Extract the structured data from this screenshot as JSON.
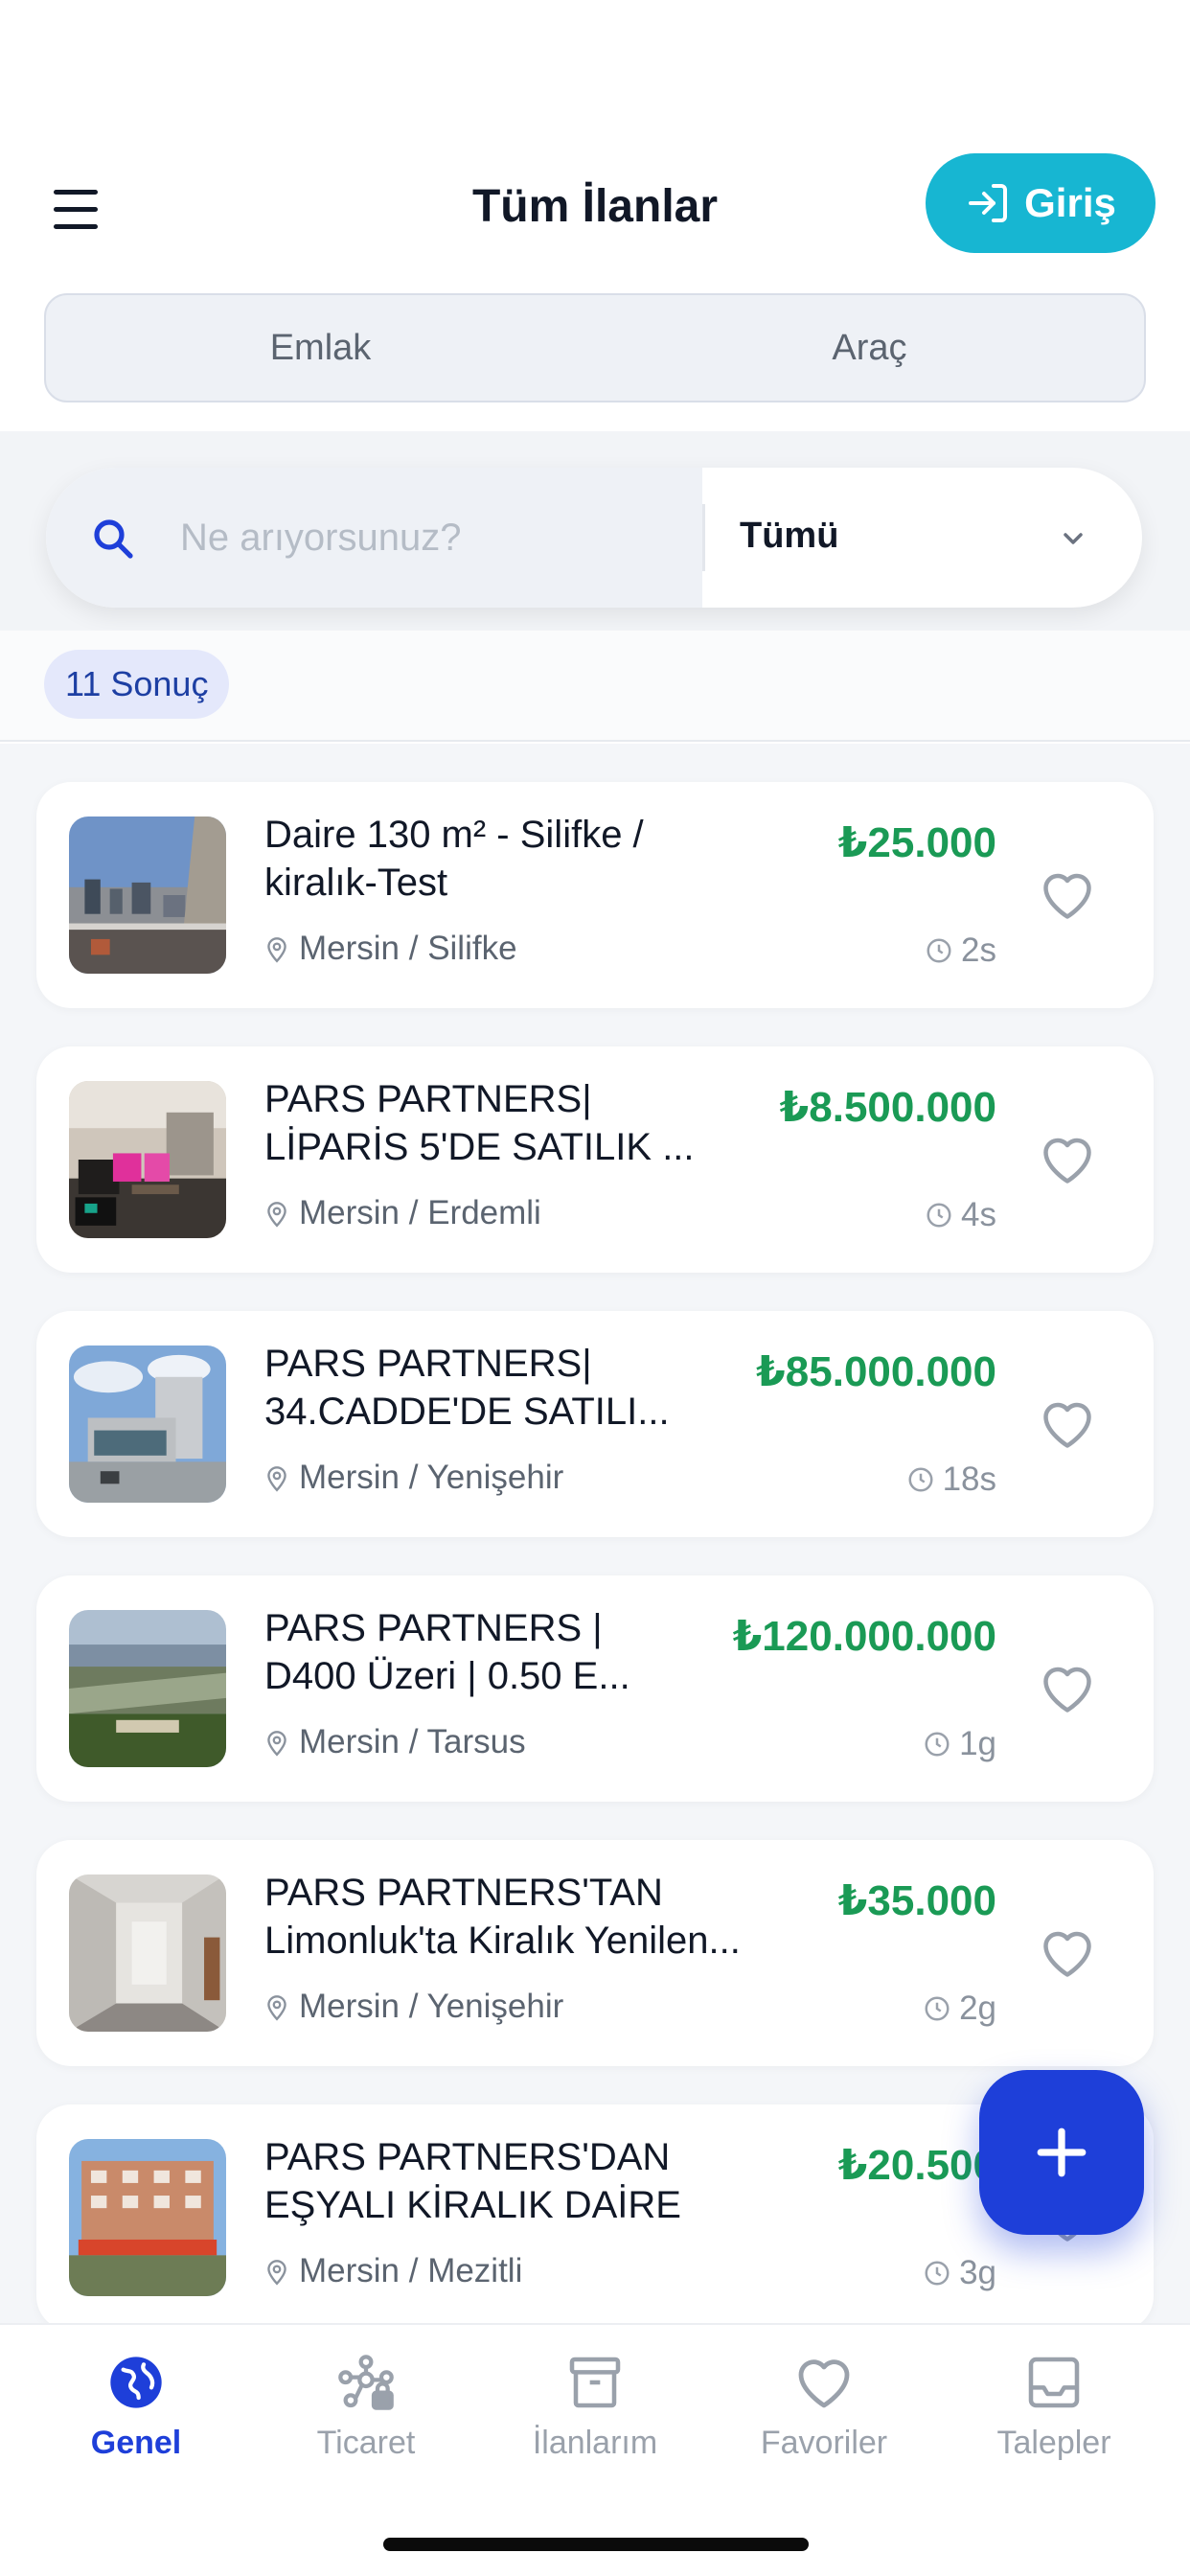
{
  "header": {
    "title": "Tüm İlanlar",
    "login_label": "Giriş",
    "menu_icon": "hamburger-menu-icon",
    "login_icon": "sign-in-icon"
  },
  "categories": [
    {
      "label": "Emlak"
    },
    {
      "label": "Araç"
    }
  ],
  "search": {
    "placeholder": "Ne arıyorsunuz?",
    "value": "",
    "filter_selected": "Tümü"
  },
  "results": {
    "count_label": "11 Sonuç"
  },
  "listings": [
    {
      "title_line1": "Daire 130 m² - Silifke /",
      "title_line2": "kiralık-Test",
      "price": "₺25.000",
      "location": "Mersin / Silifke",
      "time": "2s"
    },
    {
      "title_line1": "PARS PARTNERS|",
      "title_line2": "LİPARİS 5'DE SATILIK ...",
      "price": "₺8.500.000",
      "location": "Mersin / Erdemli",
      "time": "4s"
    },
    {
      "title_line1": "PARS PARTNERS|",
      "title_line2": "34.CADDE'DE SATILI...",
      "price": "₺85.000.000",
      "location": "Mersin / Yenişehir",
      "time": "18s"
    },
    {
      "title_line1": "PARS PARTNERS |",
      "title_line2": "D400 Üzeri | 0.50 E...",
      "price": "₺120.000.000",
      "location": "Mersin / Tarsus",
      "time": "1g"
    },
    {
      "title_line1": "PARS PARTNERS'TAN",
      "title_line2": "Limonluk'ta Kiralık Yenilen...",
      "price": "₺35.000",
      "location": "Mersin / Yenişehir",
      "time": "2g"
    },
    {
      "title_line1": "PARS PARTNERS'DAN",
      "title_line2": "EŞYALI KİRALIK DAİRE",
      "price": "₺20.500",
      "location": "Mersin / Mezitli",
      "time": "3g"
    }
  ],
  "nav": [
    {
      "label": "Genel",
      "icon": "globe-icon",
      "active": true
    },
    {
      "label": "Ticaret",
      "icon": "network-lock-icon",
      "active": false
    },
    {
      "label": "İlanlarım",
      "icon": "archive-box-icon",
      "active": false
    },
    {
      "label": "Favoriler",
      "icon": "heart-icon",
      "active": false
    },
    {
      "label": "Talepler",
      "icon": "inbox-tray-icon",
      "active": false
    }
  ],
  "colors": {
    "accent": "#1e3fd9",
    "login": "#17b6d2",
    "price": "#1a9a55"
  }
}
